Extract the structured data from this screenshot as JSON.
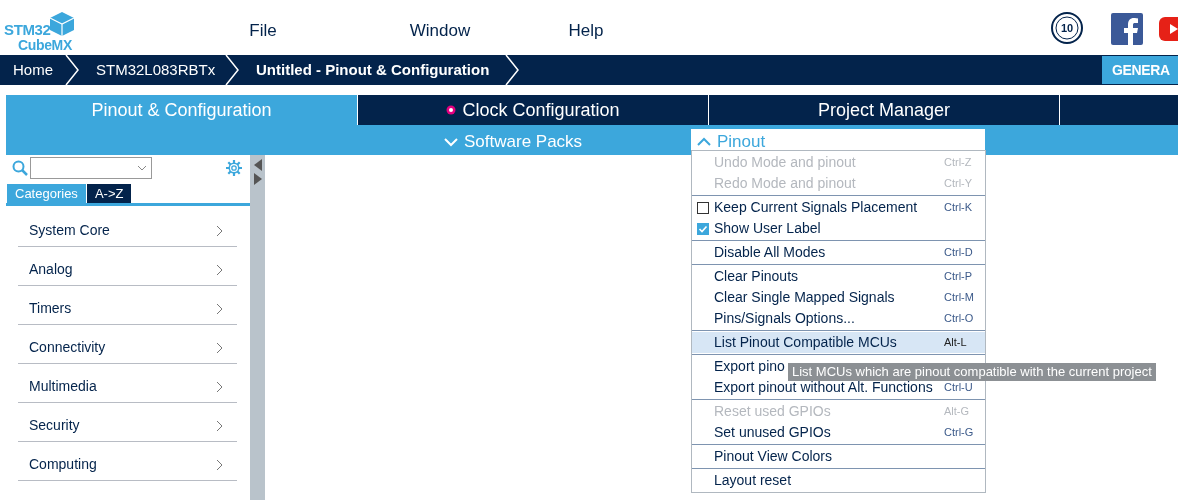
{
  "logo": {
    "line_1": "STM32",
    "line_2": "CubeMX"
  },
  "menu": [
    "File",
    "Window",
    "Help"
  ],
  "badge_text": "10",
  "breadcrumbs": [
    {
      "label": "Home",
      "selected": false
    },
    {
      "label": "STM32L083RBTx",
      "selected": false
    },
    {
      "label": "Untitled - Pinout & Configuration",
      "selected": true
    }
  ],
  "generate_button": "GENERA",
  "tabs": [
    {
      "label": "Pinout & Configuration",
      "selected": true,
      "alert": false
    },
    {
      "label": "Clock Configuration",
      "selected": false,
      "alert": true
    },
    {
      "label": "Project Manager",
      "selected": false,
      "alert": false
    },
    {
      "selected": false,
      "alert": false
    }
  ],
  "subbar": {
    "software_packs": "Software Packs",
    "pinout": "Pinout"
  },
  "sidebar": {
    "view_tabs": [
      {
        "label": "Categories",
        "selected": true
      },
      {
        "label": "A->Z",
        "selected": false
      }
    ],
    "items": [
      "System Core",
      "Analog",
      "Timers",
      "Connectivity",
      "Multimedia",
      "Security",
      "Computing"
    ]
  },
  "pinout_menu": [
    [
      {
        "label": "Undo Mode and pinout",
        "shortcut": "Ctrl-Z",
        "disabled": true
      },
      {
        "label": "Redo Mode and pinout",
        "shortcut": "Ctrl-Y",
        "disabled": true
      }
    ],
    [
      {
        "label": "Keep Current Signals Placement",
        "shortcut": "Ctrl-K",
        "disabled": false,
        "kind": "checkbox",
        "checked": false
      },
      {
        "label": "Show User Label",
        "disabled": false,
        "kind": "checkbox",
        "checked": true
      }
    ],
    [
      {
        "label": "Disable All Modes",
        "shortcut": "Ctrl-D",
        "disabled": false
      }
    ],
    [
      {
        "label": "Clear Pinouts",
        "shortcut": "Ctrl-P",
        "disabled": false
      },
      {
        "label": "Clear Single Mapped Signals",
        "shortcut": "Ctrl-M",
        "disabled": false
      },
      {
        "label": "Pins/Signals Options...",
        "shortcut": "Ctrl-O",
        "disabled": false
      }
    ],
    [
      {
        "label": "List Pinout Compatible MCUs",
        "shortcut": "Alt-L",
        "disabled": false,
        "hovered": true
      }
    ],
    [
      {
        "label": "Export pino",
        "disabled": false
      },
      {
        "label": "Export pinout without Alt. Functions",
        "shortcut": "Ctrl-U",
        "disabled": false
      }
    ],
    [
      {
        "label": "Reset used GPIOs",
        "shortcut": "Alt-G",
        "disabled": true
      },
      {
        "label": "Set unused GPIOs",
        "shortcut": "Ctrl-G",
        "disabled": false
      }
    ],
    [
      {
        "label": "Pinout View Colors",
        "disabled": false
      }
    ],
    [
      {
        "label": "Layout reset",
        "disabled": false
      }
    ]
  ],
  "tooltip": "List MCUs which are pinout compatible with the current project"
}
